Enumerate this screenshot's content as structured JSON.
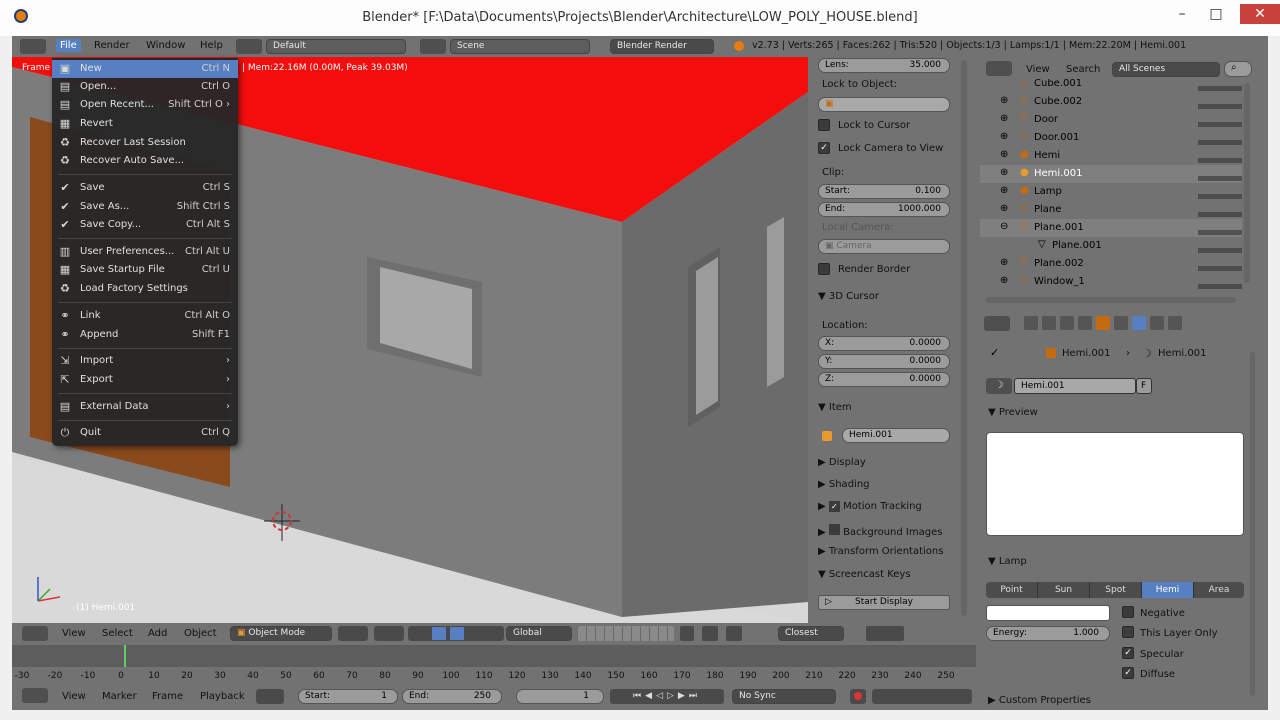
{
  "window": {
    "title": "Blender* [F:\\Data\\Documents\\Projects\\Blender\\Architecture\\LOW_POLY_HOUSE.blend]",
    "min_glyph": "–",
    "max_glyph": "□",
    "close_glyph": "✕"
  },
  "topbar": {
    "menus": [
      "File",
      "Render",
      "Window",
      "Help"
    ],
    "layout": "Default",
    "scene": "Scene",
    "engine": "Blender Render",
    "stats": "v2.73 | Verts:265 | Faces:262 | Tris:520 | Objects:1/3 | Lamps:1/1 | Mem:22.20M | Hemi.001"
  },
  "viewport": {
    "info_left": "Frame",
    "info_mem": "| Mem:22.16M (0.00M, Peak 39.03M)",
    "object_label": "(1) Hemi.001"
  },
  "file_menu": {
    "items": [
      {
        "label": "New",
        "shortcut": "Ctrl N",
        "icon": "new-file-icon"
      },
      {
        "label": "Open...",
        "shortcut": "Ctrl O",
        "icon": "open-folder-icon"
      },
      {
        "label": "Open Recent...",
        "shortcut": "Shift Ctrl O ›",
        "icon": "open-recent-icon"
      },
      {
        "label": "Revert",
        "shortcut": "",
        "icon": "revert-icon"
      },
      {
        "label": "Recover Last Session",
        "shortcut": "",
        "icon": "recover-icon"
      },
      {
        "label": "Recover Auto Save...",
        "shortcut": "",
        "icon": "recover-auto-icon"
      },
      {
        "label": "Save",
        "shortcut": "Ctrl S",
        "icon": "save-check-icon"
      },
      {
        "label": "Save As...",
        "shortcut": "Shift Ctrl S",
        "icon": "save-as-icon"
      },
      {
        "label": "Save Copy...",
        "shortcut": "Ctrl Alt S",
        "icon": "save-copy-icon"
      },
      {
        "label": "User Preferences...",
        "shortcut": "Ctrl Alt U",
        "icon": "preferences-icon"
      },
      {
        "label": "Save Startup File",
        "shortcut": "Ctrl U",
        "icon": "startup-file-icon"
      },
      {
        "label": "Load Factory Settings",
        "shortcut": "",
        "icon": "factory-settings-icon"
      },
      {
        "label": "Link",
        "shortcut": "Ctrl Alt O",
        "icon": "link-icon"
      },
      {
        "label": "Append",
        "shortcut": "Shift F1",
        "icon": "append-icon"
      },
      {
        "label": "Import",
        "shortcut": "›",
        "icon": "import-icon"
      },
      {
        "label": "Export",
        "shortcut": "›",
        "icon": "export-icon"
      },
      {
        "label": "External Data",
        "shortcut": "›",
        "icon": "external-data-icon"
      },
      {
        "label": "Quit",
        "shortcut": "Ctrl Q",
        "icon": "quit-icon"
      }
    ]
  },
  "npanel": {
    "lens_label": "Lens:",
    "lens_value": "35.000",
    "lock_to_object": "Lock to Object:",
    "lock_to_cursor": "Lock to Cursor",
    "lock_camera": "Lock Camera to View",
    "clip": "Clip:",
    "clip_start_label": "Start:",
    "clip_start": "0.100",
    "clip_end_label": "End:",
    "clip_end": "1000.000",
    "local_camera": "Local Camera:",
    "camera_field": "Camera",
    "render_border": "Render Border",
    "cursor_section": "3D Cursor",
    "location": "Location:",
    "x_label": "X:",
    "x_value": "0.0000",
    "y_label": "Y:",
    "y_value": "0.0000",
    "z_label": "Z:",
    "z_value": "0.0000",
    "item_section": "Item",
    "item_name": "Hemi.001",
    "collapsed": [
      "Display",
      "Shading",
      "Motion Tracking",
      "Background Images",
      "Transform Orientations"
    ],
    "screencast_section": "Screencast Keys",
    "start_display": "Start Display"
  },
  "outliner": {
    "view": "View",
    "search": "Search",
    "filter": "All Scenes",
    "rows": [
      "Cube.001",
      "Cube.002",
      "Door",
      "Door.001",
      "Hemi",
      "Hemi.001",
      "Lamp",
      "Plane",
      "Plane.001",
      "Plane.001",
      "Plane.002",
      "Window_1"
    ]
  },
  "properties": {
    "breadcrumb_a": "Hemi.001",
    "breadcrumb_b": "Hemi.001",
    "datablock": "Hemi.001",
    "datablock_users": "F",
    "preview": "Preview",
    "lamp": "Lamp",
    "lamp_types": [
      "Point",
      "Sun",
      "Spot",
      "Hemi",
      "Area"
    ],
    "lamp_active": "Hemi",
    "energy_label": "Energy:",
    "energy_value": "1.000",
    "negative": "Negative",
    "this_layer_only": "This Layer Only",
    "specular": "Specular",
    "diffuse": "Diffuse",
    "custom_properties": "Custom Properties"
  },
  "viewport_header": {
    "menus": [
      "View",
      "Select",
      "Add",
      "Object"
    ],
    "mode": "Object Mode",
    "orientation": "Global",
    "snap": "Closest"
  },
  "timeline": {
    "ticks": [
      "-30",
      "-20",
      "-10",
      "0",
      "10",
      "20",
      "30",
      "40",
      "50",
      "60",
      "70",
      "80",
      "90",
      "100",
      "110",
      "120",
      "130",
      "140",
      "150",
      "160",
      "170",
      "180",
      "190",
      "200",
      "210",
      "220",
      "230",
      "240",
      "250"
    ],
    "menus": [
      "View",
      "Marker",
      "Frame",
      "Playback"
    ],
    "start_label": "Start:",
    "start": "1",
    "end_label": "End:",
    "end": "250",
    "current": "1",
    "sync": "No Sync"
  },
  "colors": {
    "roof": "#f40d0d",
    "wall_front": "#7c7c7c",
    "wall_side": "#6b6b6b",
    "door": "#8a4a1c",
    "highlight": "#5680c2",
    "panel": "#727272"
  }
}
